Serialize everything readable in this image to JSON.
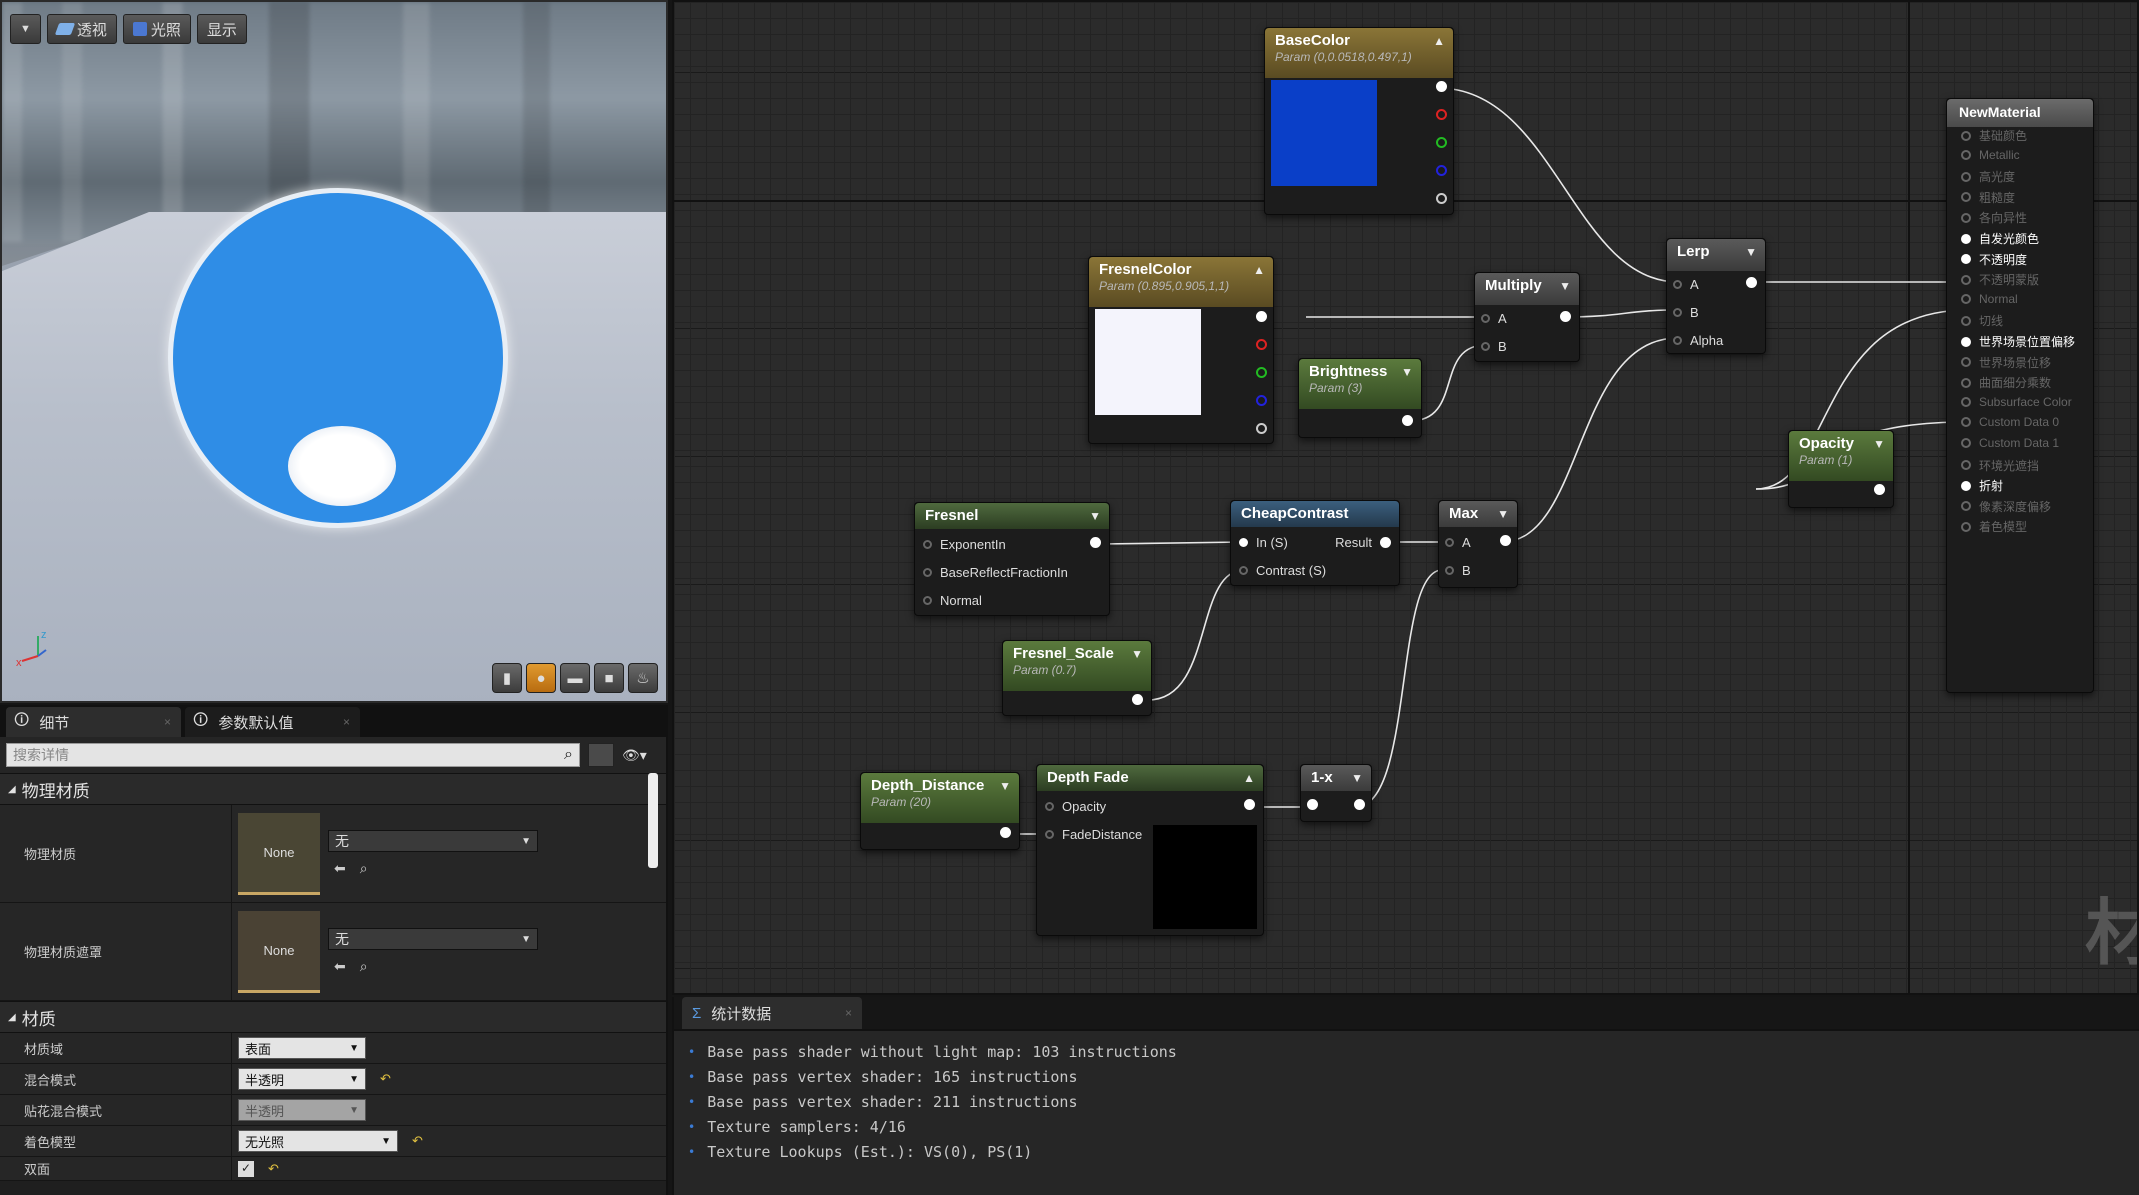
{
  "viewport": {
    "buttons": [
      {
        "label": "透视"
      },
      {
        "label": "光照"
      },
      {
        "label": "显示"
      }
    ],
    "menu_icon": "chevron-down-icon",
    "preview_icons": [
      "cylinder-icon",
      "sphere-icon",
      "plane-icon",
      "cube-icon",
      "teapot-icon"
    ],
    "axis": {
      "x": "x",
      "z": "z"
    },
    "colors": {
      "sphere": "#2f8de6",
      "rim": "#e8eef5"
    }
  },
  "details": {
    "tabs": [
      {
        "label": "细节"
      },
      {
        "label": "参数默认值"
      }
    ],
    "search_placeholder": "搜索详情",
    "sections": {
      "physical": "物理材质",
      "material": "材质"
    },
    "physical_rows": [
      {
        "label": "物理材质",
        "thumb": "None",
        "value": "无"
      },
      {
        "label": "物理材质遮罩",
        "thumb": "None",
        "value": "无"
      }
    ],
    "material_rows": [
      {
        "label": "材质域",
        "value": "表面"
      },
      {
        "label": "混合模式",
        "value": "半透明"
      },
      {
        "label": "贴花混合模式",
        "value": "半透明"
      },
      {
        "label": "着色模型",
        "value": "无光照"
      },
      {
        "label": "双面",
        "value": "✓"
      }
    ]
  },
  "graph": {
    "nodes": {
      "basecolor": {
        "title": "BaseColor",
        "sub": "Param (0,0.0518,0.497,1)",
        "swatch": "#0a3fc8"
      },
      "fresnelcolor": {
        "title": "FresnelColor",
        "sub": "Param (0.895,0.905,1,1)",
        "swatch": "#f4f4fc"
      },
      "brightness": {
        "title": "Brightness",
        "sub": "Param (3)"
      },
      "multiply": {
        "title": "Multiply",
        "pins": [
          "A",
          "B"
        ]
      },
      "lerp": {
        "title": "Lerp",
        "pins": [
          "A",
          "B",
          "Alpha"
        ]
      },
      "opacity": {
        "title": "Opacity",
        "sub": "Param (1)"
      },
      "fresnel": {
        "title": "Fresnel",
        "pins": [
          "ExponentIn",
          "BaseReflectFractionIn",
          "Normal"
        ]
      },
      "cheapcontrast": {
        "title": "CheapContrast",
        "pins": [
          "In (S)",
          "Contrast (S)"
        ],
        "out": "Result"
      },
      "max": {
        "title": "Max",
        "pins": [
          "A",
          "B"
        ]
      },
      "fresnel_scale": {
        "title": "Fresnel_Scale",
        "sub": "Param (0.7)"
      },
      "depth_distance": {
        "title": "Depth_Distance",
        "sub": "Param (20)"
      },
      "depthfade": {
        "title": "Depth Fade",
        "pins": [
          "Opacity",
          "FadeDistance"
        ]
      },
      "oneminus": {
        "title": "1-x"
      }
    },
    "material": {
      "title": "NewMaterial",
      "inputs": [
        {
          "label": "基础颜色",
          "active": false
        },
        {
          "label": "Metallic",
          "active": false
        },
        {
          "label": "高光度",
          "active": false
        },
        {
          "label": "粗糙度",
          "active": false
        },
        {
          "label": "各向异性",
          "active": false
        },
        {
          "label": "自发光颜色",
          "active": true
        },
        {
          "label": "不透明度",
          "active": true
        },
        {
          "label": "不透明蒙版",
          "active": false
        },
        {
          "label": "Normal",
          "active": false
        },
        {
          "label": "切线",
          "active": false
        },
        {
          "label": "世界场景位置偏移",
          "active": true
        },
        {
          "label": "世界场景位移",
          "active": false
        },
        {
          "label": "曲面细分乘数",
          "active": false
        },
        {
          "label": "Subsurface Color",
          "active": false
        },
        {
          "label": "Custom Data 0",
          "active": false
        },
        {
          "label": "Custom Data 1",
          "active": false
        },
        {
          "label": "环境光遮挡",
          "active": false
        },
        {
          "label": "折射",
          "active": true
        },
        {
          "label": "像素深度偏移",
          "active": false
        },
        {
          "label": "着色模型",
          "active": false
        }
      ]
    },
    "watermark": "材"
  },
  "stats": {
    "tab": "统计数据",
    "lines": [
      "Base pass shader without light map: 103 instructions",
      "Base pass vertex shader: 165 instructions",
      "Base pass vertex shader: 211 instructions",
      "Texture samplers: 4/16",
      "Texture Lookups (Est.): VS(0), PS(1)"
    ]
  }
}
